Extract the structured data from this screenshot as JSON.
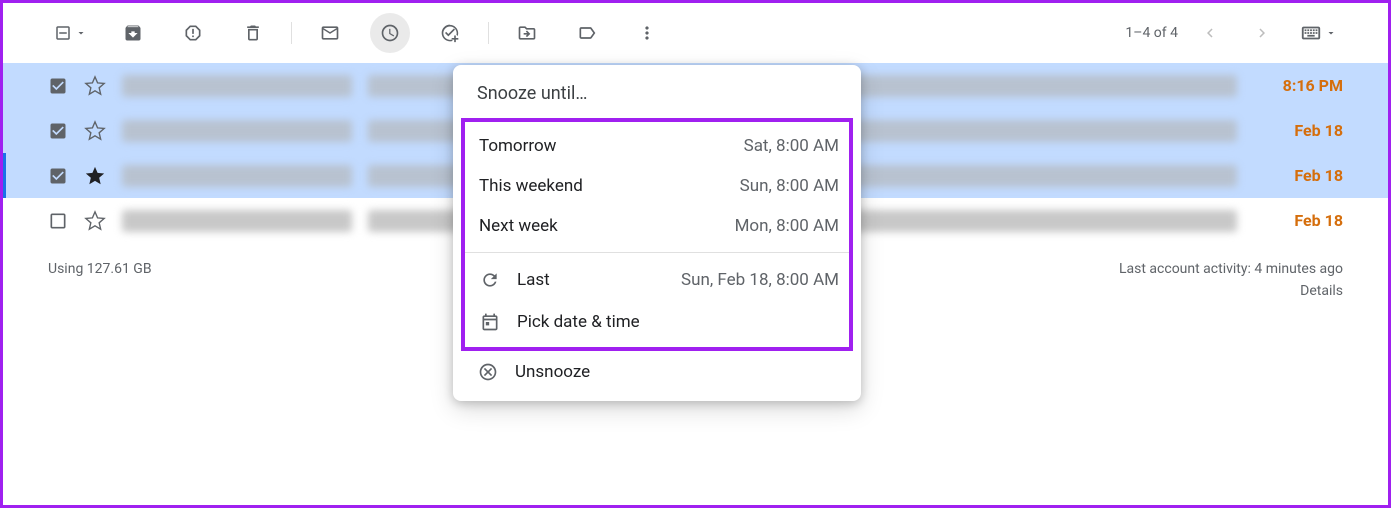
{
  "pagination": {
    "text": "1–4 of 4"
  },
  "emails": [
    {
      "selected": true,
      "starred": false,
      "time": "8:16 PM",
      "border": false
    },
    {
      "selected": true,
      "starred": false,
      "time": "Feb 18",
      "border": false
    },
    {
      "selected": true,
      "starred": true,
      "time": "Feb 18",
      "border": true
    },
    {
      "selected": false,
      "starred": false,
      "time": "Feb 18",
      "border": false
    }
  ],
  "snooze": {
    "title": "Snooze until…",
    "options": [
      {
        "label": "Tomorrow",
        "subtext": "Sat, 8:00 AM"
      },
      {
        "label": "This weekend",
        "subtext": "Sun, 8:00 AM"
      },
      {
        "label": "Next week",
        "subtext": "Mon, 8:00 AM"
      }
    ],
    "last": {
      "label": "Last",
      "subtext": "Sun, Feb 18, 8:00 AM"
    },
    "pick": {
      "label": "Pick date & time"
    },
    "unsnooze": {
      "label": "Unsnooze"
    }
  },
  "footer": {
    "storage": "Using 127.61 GB",
    "activity": "Last account activity: 4 minutes ago",
    "details": "Details"
  }
}
